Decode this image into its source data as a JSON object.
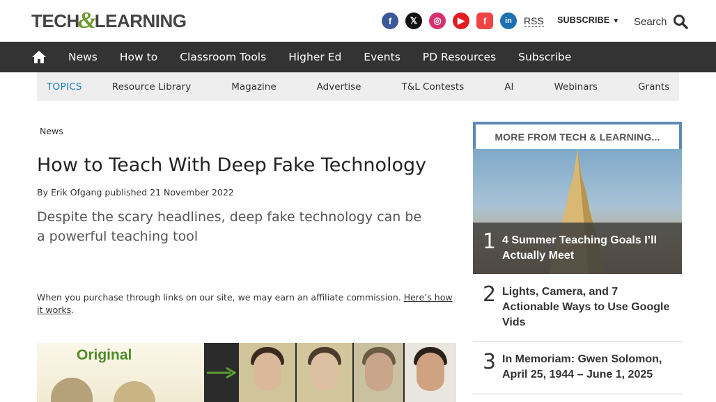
{
  "header": {
    "logo_text_left": "TECH",
    "logo_amp": "&",
    "logo_text_right": "LEARNING",
    "socials": [
      {
        "name": "facebook",
        "glyph": "f",
        "color": "#3b5998"
      },
      {
        "name": "x",
        "glyph": "𝕏",
        "color": "#111111"
      },
      {
        "name": "instagram",
        "glyph": "◎",
        "color": "#d6306e"
      },
      {
        "name": "youtube",
        "glyph": "▶",
        "color": "#e31b23"
      },
      {
        "name": "flipboard",
        "glyph": "f",
        "color": "#ef4444"
      },
      {
        "name": "linkedin",
        "glyph": "in",
        "color": "#1c6fb3"
      }
    ],
    "rss_label": "RSS",
    "subscribe_label": "SUBSCRIBE",
    "search_label": "Search"
  },
  "nav": {
    "home_icon": "home-icon",
    "items": [
      "News",
      "How to",
      "Classroom Tools",
      "Higher Ed",
      "Events",
      "PD Resources",
      "Subscribe"
    ]
  },
  "topics": {
    "label": "TOPICS",
    "items": [
      "Resource Library",
      "Magazine",
      "Advertise",
      "T&L Contests",
      "AI",
      "Webinars",
      "Grants"
    ]
  },
  "article": {
    "breadcrumb": "News",
    "title": "How to Teach With Deep Fake Technology",
    "byline_prefix": "By",
    "author": "Erik Ofgang",
    "published_word": "published",
    "date": "21 November 2022",
    "strapline": "Despite the scary headlines, deep fake technology can be a powerful teaching tool",
    "affiliate_text": "When you purchase through links on our site, we may earn an affiliate commission.",
    "affiliate_link": "Here’s how it works",
    "affiliate_end": ".",
    "hero_label": "Original"
  },
  "sidebar": {
    "title": "MORE FROM TECH & LEARNING...",
    "stories": [
      {
        "rank": "1",
        "title": "4 Summer Teaching Goals I’ll Actually Meet"
      },
      {
        "rank": "2",
        "title": "Lights, Camera, and 7 Actionable Ways to Use Google Vids"
      },
      {
        "rank": "3",
        "title": "In Memoriam: Gwen Solomon, April 25, 1944 – June 1, 2025"
      }
    ]
  },
  "colors": {
    "nav_bg": "#333333",
    "topics_bg": "#eeeeee",
    "topics_label": "#1a7fb8",
    "sidebar_border": "#5b8ab5",
    "logo_amp": "#6a9a2c"
  }
}
